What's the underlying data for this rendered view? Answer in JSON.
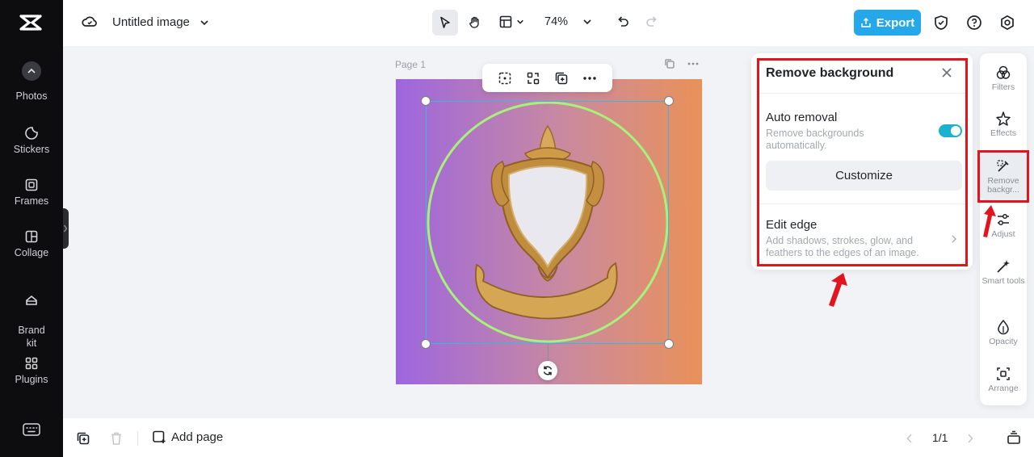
{
  "app": {
    "title": "Untitled image",
    "zoom": "74%",
    "export_label": "Export"
  },
  "left_rail": {
    "items": [
      {
        "label": "Photos",
        "icon": "photo-icon"
      },
      {
        "label": "Stickers",
        "icon": "sticker-icon"
      },
      {
        "label": "Frames",
        "icon": "frame-icon"
      },
      {
        "label": "Collage",
        "icon": "collage-icon"
      },
      {
        "label": "Brand\nkit",
        "icon": "brand-kit-icon"
      },
      {
        "label": "Plugins",
        "icon": "plugins-icon"
      }
    ]
  },
  "canvas": {
    "page_label": "Page 1"
  },
  "panel": {
    "title": "Remove background",
    "auto_title": "Auto removal",
    "auto_desc": "Remove backgrounds automatically.",
    "auto_on": true,
    "customize_label": "Customize",
    "edge_title": "Edit edge",
    "edge_desc": "Add shadows, strokes, glow, and feathers to the edges of an image."
  },
  "right_tools": {
    "items": [
      {
        "label": "Filters",
        "icon": "filters-icon"
      },
      {
        "label": "Effects",
        "icon": "effects-icon"
      },
      {
        "label": "Remove backgr...",
        "icon": "remove-background-icon"
      },
      {
        "label": "Adjust",
        "icon": "adjust-icon"
      },
      {
        "label": "Smart tools",
        "icon": "smart-tools-icon"
      },
      {
        "label": "Opacity",
        "icon": "opacity-icon"
      },
      {
        "label": "Arrange",
        "icon": "arrange-icon"
      }
    ]
  },
  "bottom": {
    "add_page_label": "Add page",
    "pager": "1/1"
  },
  "colors": {
    "accent": "#24a8e9",
    "highlight": "#e3141e",
    "toggle": "#19b3cf"
  }
}
